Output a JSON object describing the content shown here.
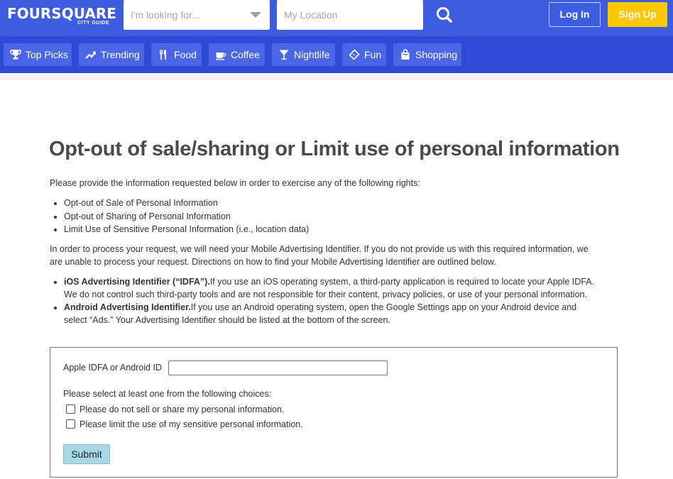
{
  "header": {
    "logo_text": "FOURSQUARE",
    "logo_subtext": "CITY GUIDE",
    "search_what_placeholder": "I'm looking for...",
    "search_where_placeholder": "My Location",
    "login_label": "Log In",
    "signup_label": "Sign Up",
    "colors": {
      "bar": "#3d5ce0",
      "signup": "#ffc700"
    }
  },
  "categories": [
    {
      "label": "Top Picks",
      "icon": "trophy-icon"
    },
    {
      "label": "Trending",
      "icon": "trending-icon"
    },
    {
      "label": "Food",
      "icon": "utensils-icon"
    },
    {
      "label": "Coffee",
      "icon": "coffee-icon"
    },
    {
      "label": "Nightlife",
      "icon": "cocktail-icon"
    },
    {
      "label": "Fun",
      "icon": "ticket-icon"
    },
    {
      "label": "Shopping",
      "icon": "shopping-bag-icon"
    }
  ],
  "page": {
    "title": "Opt-out of sale/sharing or Limit use of personal information",
    "intro": "Please provide the information requested below in order to exercise any of the following rights:",
    "rights": [
      "Opt-out of Sale of Personal Information",
      "Opt-out of Sharing of Personal Information",
      "Limit Use of Sensitive Personal Information (i.e., location data)"
    ],
    "process_line1": "In order to process your request, we will need your Mobile Advertising Identifier. If you do not provide us with this required information, we",
    "process_line2": "are unable to process your request. Directions on how to find your Mobile Advertising Identifier are outlined below.",
    "ios_bold": "iOS Advertising Identifier (“IDFA”).",
    "ios_text_1": "If you use an iOS operating system, a third-party application is required to locate your Apple IDFA.",
    "ios_text_2": "We do not control such third-party tools and are not responsible for their content, privacy policies, or use of your personal information.",
    "android_bold": "Android Advertising Identifier.",
    "android_text_1": "If you use an Android operating system, open the Google Settings app on your Android device and",
    "android_text_2": "select “Ads.” Your Advertising Identifier should be listed at the bottom of the screen."
  },
  "form": {
    "id_label": "Apple IDFA or Android ID",
    "id_value": "",
    "choice_prompt": "Please select at least one from the following choices:",
    "choice_1": "Please do not sell or share my personal information.",
    "choice_2": "Please limit the use of my sensitive personal information.",
    "submit_label": "Submit"
  }
}
